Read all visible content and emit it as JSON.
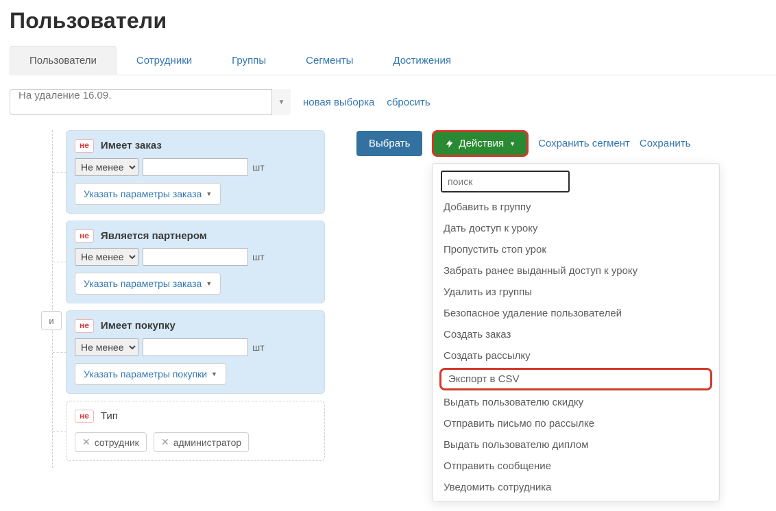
{
  "page_title": "Пользователи",
  "tabs": {
    "users": "Пользователи",
    "employees": "Сотрудники",
    "groups": "Группы",
    "segments": "Сегменты",
    "achievements": "Достижения",
    "active": "users"
  },
  "sample_bar": {
    "selected": "На удаление 16.09.",
    "new_sample": "новая выборка",
    "reset": "сбросить"
  },
  "and_label": "и",
  "filters": [
    {
      "id": "has_order",
      "negate_label": "не",
      "title": "Имеет заказ",
      "comparator": "Не менее",
      "unit": "шт",
      "params_btn": "Указать параметры заказа"
    },
    {
      "id": "is_partner",
      "negate_label": "не",
      "title": "Является партнером",
      "comparator": "Не менее",
      "unit": "шт",
      "params_btn": "Указать параметры заказа"
    },
    {
      "id": "has_purchase",
      "negate_label": "не",
      "title": "Имеет покупку",
      "comparator": "Не менее",
      "unit": "шт",
      "params_btn": "Указать параметры покупки"
    }
  ],
  "type_filter": {
    "negate_label": "не",
    "title": "Тип",
    "tags": [
      "сотрудник",
      "администратор"
    ]
  },
  "actions": {
    "select_btn": "Выбрать",
    "actions_btn": "Действия",
    "save_segment": "Сохранить сегмент",
    "save_trunc": "Сохранить"
  },
  "dropdown": {
    "search_placeholder": "поиск",
    "items": [
      "Добавить в группу",
      "Дать доступ к уроку",
      "Пропустить стоп урок",
      "Забрать ранее выданный доступ к уроку",
      "Удалить из группы",
      "Безопасное удаление пользователей",
      "Создать заказ",
      "Создать рассылку",
      "Экспорт в CSV",
      "Выдать пользователю скидку",
      "Отправить письмо по рассылке",
      "Выдать пользователю диплом",
      "Отправить сообщение",
      "Уведомить сотрудника"
    ],
    "highlight_index": 8
  }
}
